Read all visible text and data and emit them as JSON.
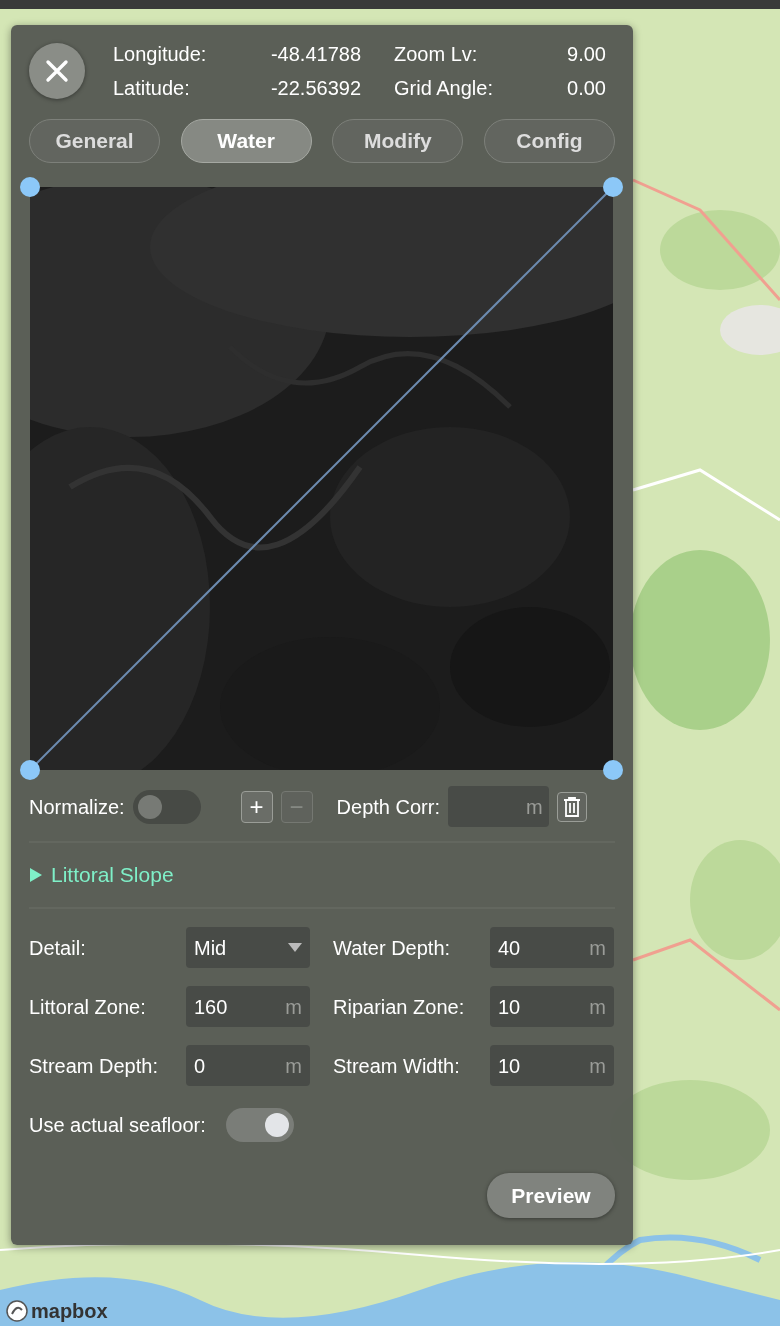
{
  "info": [
    {
      "label": "Longitude:",
      "value": "-48.41788"
    },
    {
      "label": "Zoom Lv:",
      "value": "9.00"
    },
    {
      "label": "Latitude:",
      "value": "-22.56392"
    },
    {
      "label": "Grid Angle:",
      "value": "0.00"
    }
  ],
  "tabs": [
    {
      "label": "General",
      "selected": false
    },
    {
      "label": "Water",
      "selected": true
    },
    {
      "label": "Modify",
      "selected": false
    },
    {
      "label": "Config",
      "selected": false
    }
  ],
  "normalize": {
    "label": "Normalize:",
    "on": false
  },
  "step_buttons": [
    {
      "label": "+",
      "disabled": false
    },
    {
      "label": "−",
      "disabled": true
    }
  ],
  "depth_corr": {
    "label": "Depth Corr:",
    "unit": "m"
  },
  "section": {
    "label": "Littoral Slope",
    "expanded": false
  },
  "fields": [
    {
      "kind": "select",
      "label": "Detail:",
      "value": "Mid"
    },
    {
      "kind": "number",
      "label": "Water Depth:",
      "value": "40",
      "unit": "m"
    },
    {
      "kind": "number",
      "label": "Littoral Zone:",
      "value": "160",
      "unit": "m"
    },
    {
      "kind": "number",
      "label": "Riparian Zone:",
      "value": "10",
      "unit": "m"
    },
    {
      "kind": "number",
      "label": "Stream Depth:",
      "value": "0",
      "unit": "m"
    },
    {
      "kind": "number",
      "label": "Stream Width:",
      "value": "10",
      "unit": "m"
    }
  ],
  "seafloor": {
    "label": "Use actual seafloor:",
    "on": true
  },
  "preview_button": "Preview",
  "attribution": "mapbox"
}
